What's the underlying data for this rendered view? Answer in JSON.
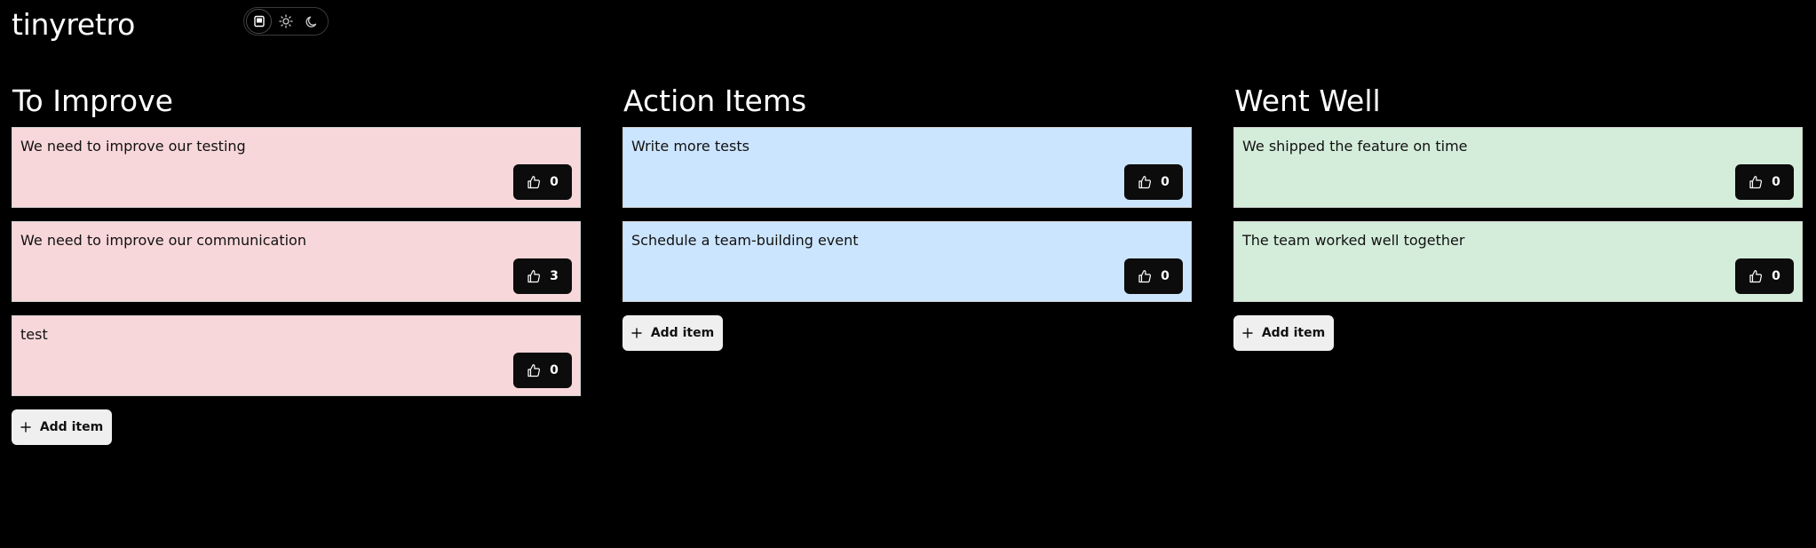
{
  "app": {
    "title": "tinyretro"
  },
  "theme_switch": {
    "options": [
      {
        "icon": "system-icon",
        "active": true
      },
      {
        "icon": "sun-icon",
        "active": false
      },
      {
        "icon": "moon-icon",
        "active": false
      }
    ]
  },
  "colors": {
    "background": "#000000",
    "to_improve_card": "#f8d7da",
    "action_items_card": "#cce5ff",
    "went_well_card": "#d4edda",
    "vote_button": "#0c0c0c",
    "add_button": "#efefef"
  },
  "columns": [
    {
      "title": "To Improve",
      "add_label": "Add item",
      "items": [
        {
          "text": "We need to improve our testing",
          "votes": "0"
        },
        {
          "text": "We need to improve our communication",
          "votes": "3"
        },
        {
          "text": "test",
          "votes": "0"
        }
      ]
    },
    {
      "title": "Action Items",
      "add_label": "Add item",
      "items": [
        {
          "text": "Write more tests",
          "votes": "0"
        },
        {
          "text": "Schedule a team-building event",
          "votes": "0"
        }
      ]
    },
    {
      "title": "Went Well",
      "add_label": "Add item",
      "items": [
        {
          "text": "We shipped the feature on time",
          "votes": "0"
        },
        {
          "text": "The team worked well together",
          "votes": "0"
        }
      ]
    }
  ]
}
